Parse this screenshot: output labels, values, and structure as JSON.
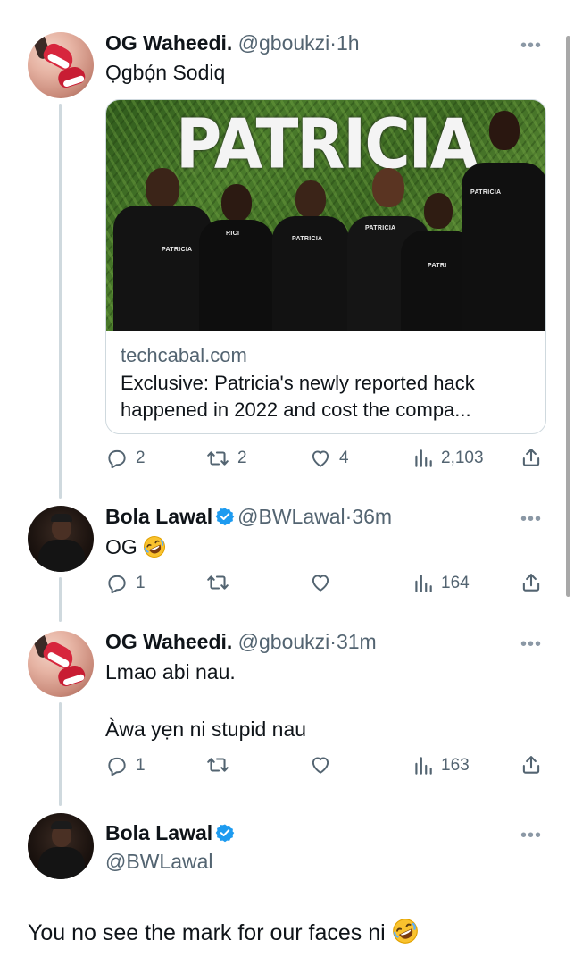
{
  "tweets": [
    {
      "name": "OG Waheedi.",
      "handle": "@gboukzi",
      "time": "1h",
      "verified": false,
      "text": "Ọgbọ́n Sodiq",
      "card": {
        "image_sign": "PATRICIA",
        "domain": "techcabal.com",
        "title_line1": "Exclusive: Patricia's newly reported hack",
        "title_line2": "happened in 2022 and cost the compa..."
      },
      "replies": "2",
      "retweets": "2",
      "likes": "4",
      "views": "2,103"
    },
    {
      "name": "Bola Lawal",
      "handle": "@BWLawal",
      "time": "36m",
      "verified": true,
      "text": "OG",
      "emoji": "rofl-emoji",
      "replies": "1",
      "retweets": "",
      "likes": "",
      "views": "164"
    },
    {
      "name": "OG Waheedi.",
      "handle": "@gboukzi",
      "time": "31m",
      "verified": false,
      "text_line1": "Lmao abi nau.",
      "text_line2": "Àwa yẹn ni stupid nau",
      "replies": "1",
      "retweets": "",
      "likes": "",
      "views": "163"
    },
    {
      "name": "Bola Lawal",
      "handle": "@BWLawal",
      "verified": true,
      "text": "You no see the mark for our faces ni",
      "emoji": "rofl-emoji"
    }
  ],
  "separator": "·",
  "more_glyph": "•••",
  "colors": {
    "text": "#0f1419",
    "secondary": "#536471",
    "verified": "#1d9bf0",
    "thread_line": "#cfd9de"
  }
}
